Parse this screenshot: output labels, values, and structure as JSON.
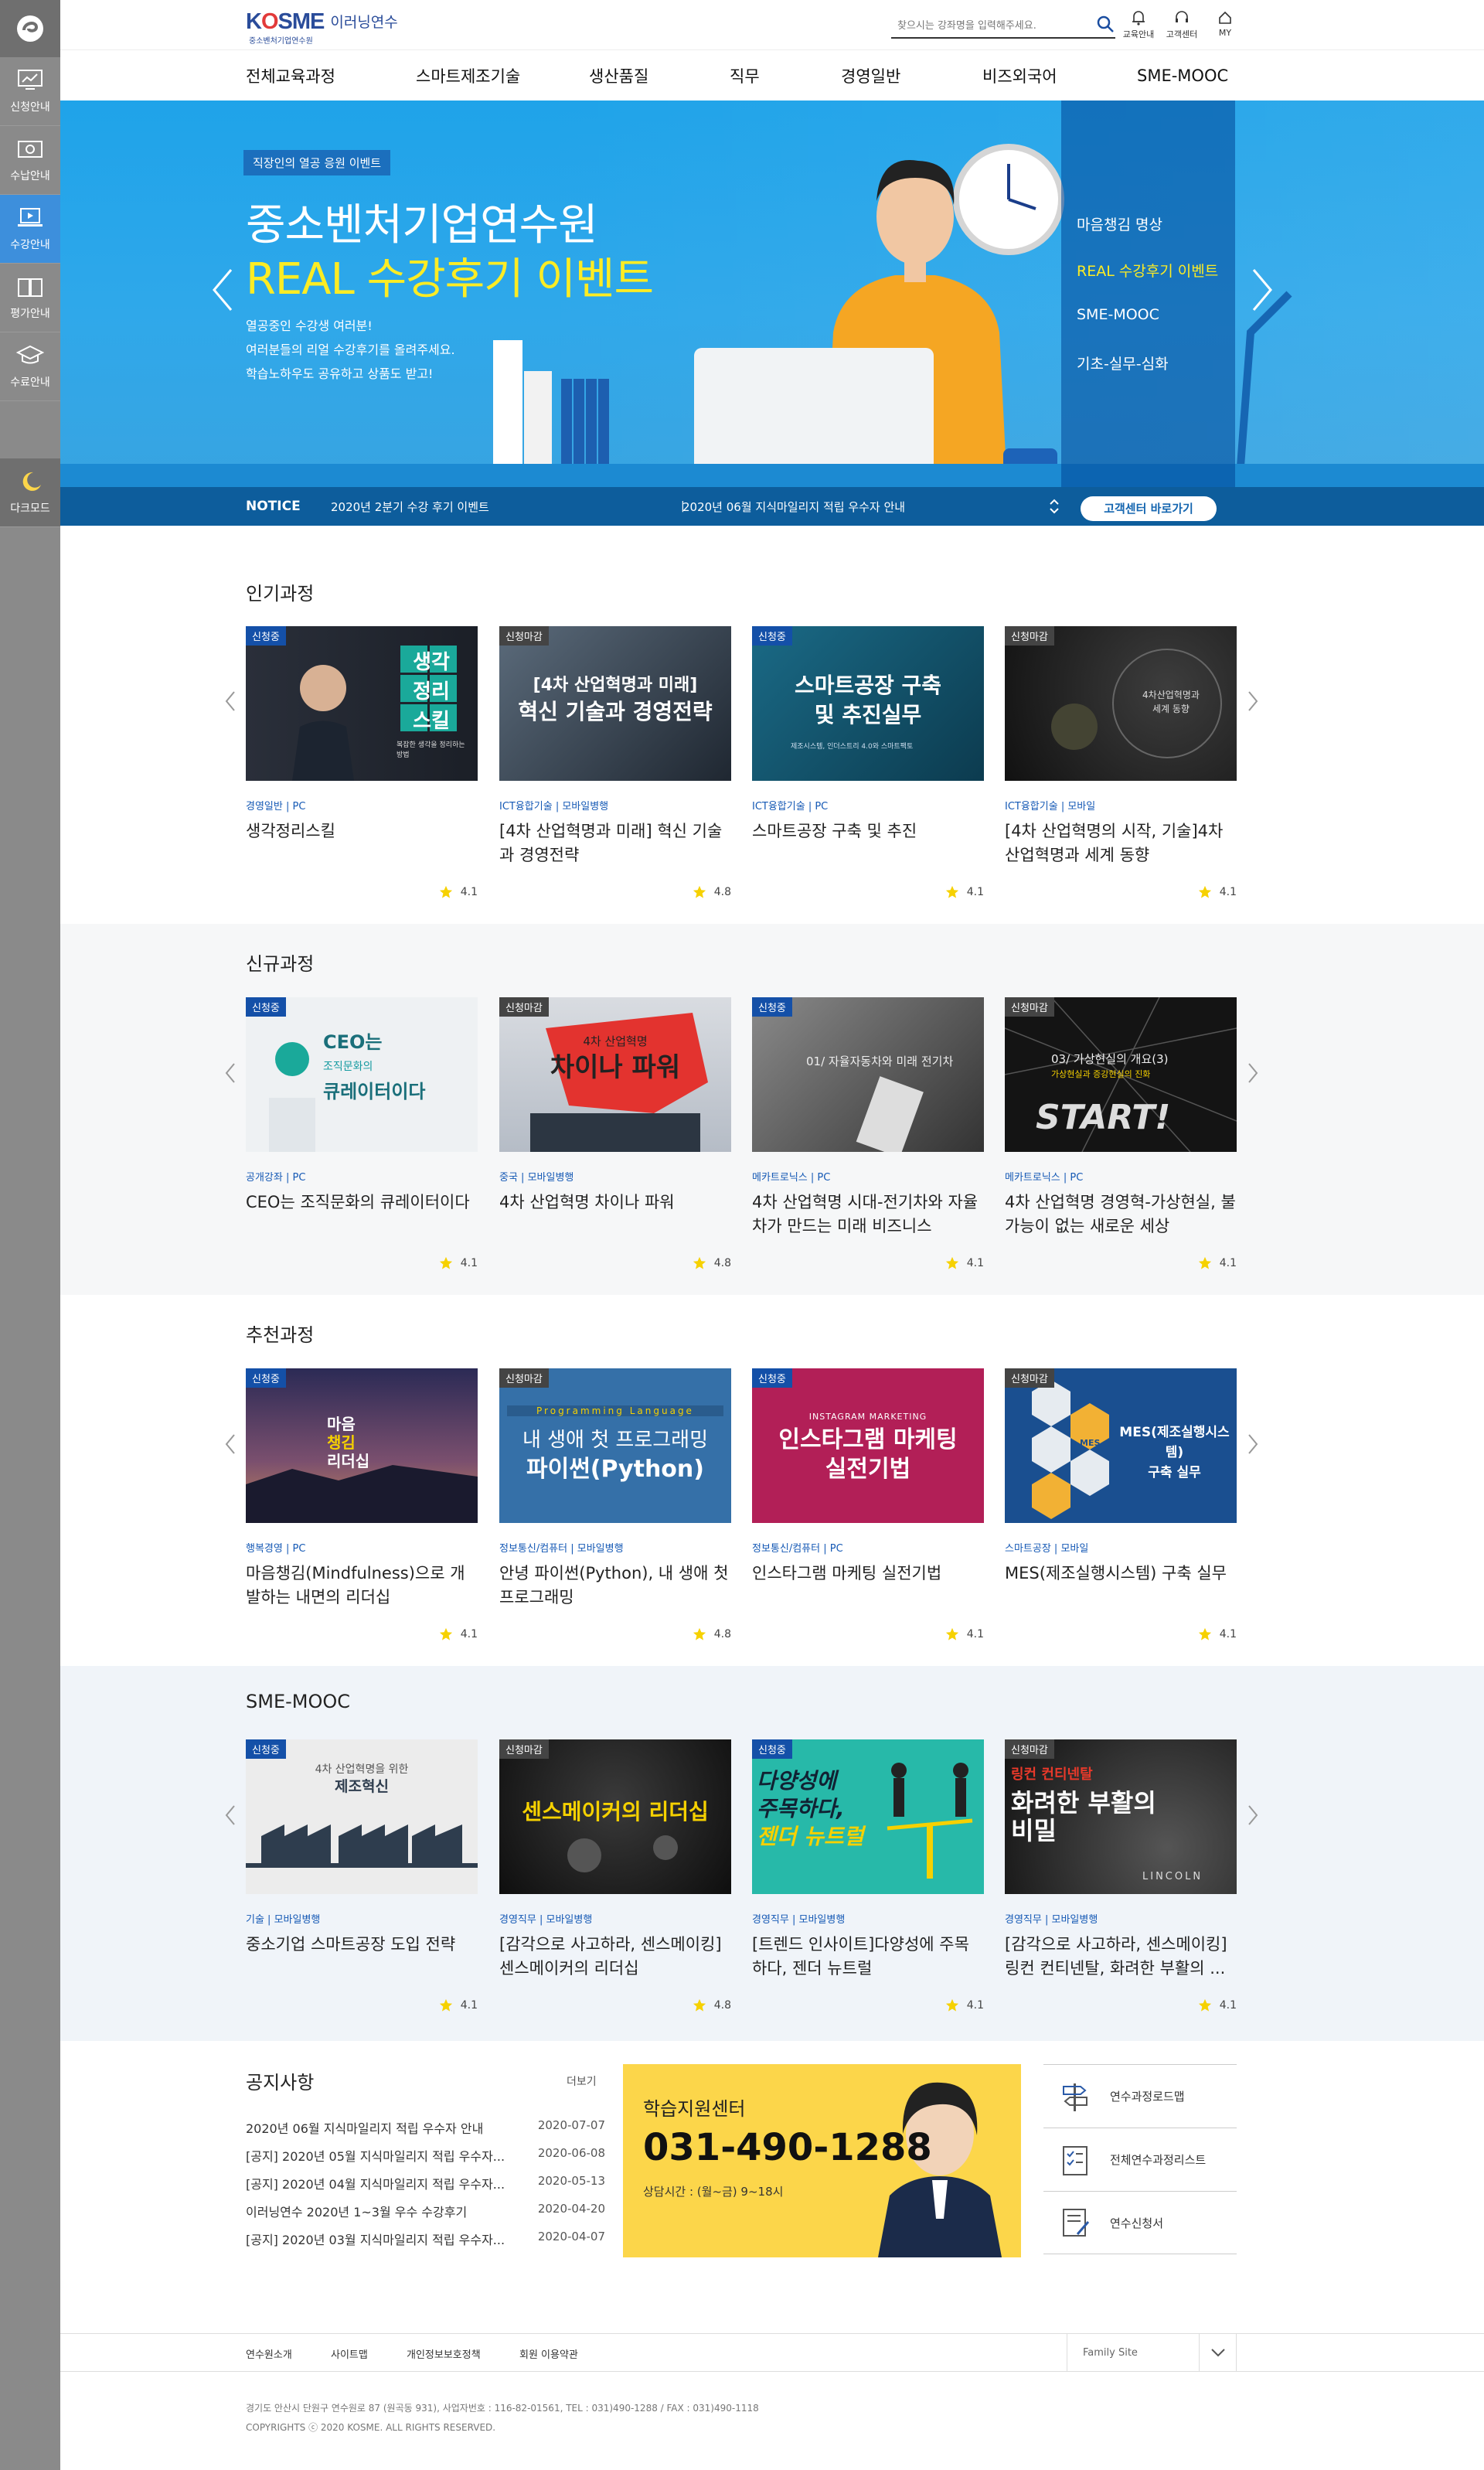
{
  "sidebar": {
    "items": [
      {
        "label": "신청안내",
        "icon": "monitor-icon"
      },
      {
        "label": "수납안내",
        "icon": "card-icon"
      },
      {
        "label": "수강안내",
        "icon": "laptop-icon"
      },
      {
        "label": "평가안내",
        "icon": "book-icon"
      },
      {
        "label": "수료안내",
        "icon": "grad-cap-icon"
      }
    ],
    "dark_mode": "다크모드"
  },
  "header": {
    "logo_text": "KOSME",
    "logo_sub": "중소벤처기업연수원",
    "logo_name": "이러닝연수",
    "search_placeholder": "찾으시는 강좌명을 입력해주세요.",
    "icons": [
      {
        "label": "교육안내",
        "icon": "bell-icon"
      },
      {
        "label": "고객센터",
        "icon": "headset-icon"
      },
      {
        "label": "MY",
        "icon": "home-icon"
      }
    ]
  },
  "gnb": [
    "전체교육과정",
    "스마트제조기술",
    "생산품질",
    "직무",
    "경영일반",
    "비즈외국어",
    "SME-MOOC"
  ],
  "hero": {
    "badge": "직장인의 열공 응원 이벤트",
    "title1": "중소벤처기업연수원",
    "title2": "REAL 수강후기 이벤트",
    "desc": [
      "열공중인 수강생 여러분!",
      "여러분들의 리얼 수강후기를 올려주세요.",
      "학습노하우도 공유하고 상품도 받고!"
    ],
    "menu": [
      "마음챙김 명상",
      "REAL 수강후기 이벤트",
      "SME-MOOC",
      "기초-실무-심화"
    ],
    "notice_label": "NOTICE",
    "notice_1": "2020년 2분기 수강 후기 이벤트",
    "notice_2": "2020년 06월 지식마일리지 적립 우수자 안내",
    "cs_button": "고객센터 바로가기"
  },
  "sections": [
    {
      "title": "인기과정",
      "cards": [
        {
          "tag": "신청중",
          "cat": "경영일반 | PC",
          "title": "생각정리스킬",
          "rating": "4.1"
        },
        {
          "tag": "신청마감",
          "cat": "ICT융합기술 | 모바일병행",
          "title": "[4차 산업혁명과 미래] 혁신 기술과 경영전략",
          "rating": "4.8"
        },
        {
          "tag": "신청중",
          "cat": "ICT융합기술 | PC",
          "title": "스마트공장 구축 및 추진",
          "rating": "4.1"
        },
        {
          "tag": "신청마감",
          "cat": "ICT융합기술 | 모바일",
          "title": "[4차 산업혁명의 시작, 기술]4차 산업혁명과 세계 동향",
          "rating": "4.1"
        }
      ]
    },
    {
      "title": "신규과정",
      "cards": [
        {
          "tag": "신청중",
          "cat": "공개강좌 | PC",
          "title": "CEO는 조직문화의 큐레이터이다",
          "rating": "4.1"
        },
        {
          "tag": "신청마감",
          "cat": "중국 | 모바일병행",
          "title": "4차 산업혁명 차이나 파워",
          "rating": "4.8"
        },
        {
          "tag": "신청중",
          "cat": "메카트로닉스 | PC",
          "title": "4차 산업혁명 시대-전기차와 자율차가 만드는 미래 비즈니스",
          "rating": "4.1"
        },
        {
          "tag": "신청마감",
          "cat": "메카트로닉스 | PC",
          "title": "4차 산업혁명 경영혁-가상현실, 불가능이 없는 새로운 세상",
          "rating": "4.1"
        }
      ]
    },
    {
      "title": "추천과정",
      "cards": [
        {
          "tag": "신청중",
          "cat": "행복경영 | PC",
          "title": "마음챙김(Mindfulness)으로 개발하는 내면의 리더십",
          "rating": "4.1"
        },
        {
          "tag": "신청마감",
          "cat": "정보통신/컴퓨터 | 모바일병행",
          "title": "안녕 파이썬(Python), 내 생애 첫 프로그래밍",
          "rating": "4.8"
        },
        {
          "tag": "신청중",
          "cat": "정보통신/컴퓨터 | PC",
          "title": "인스타그램 마케팅 실전기법",
          "rating": "4.1"
        },
        {
          "tag": "신청마감",
          "cat": "스마트공장 | 모바일",
          "title": "MES(제조실행시스템) 구축 실무",
          "rating": "4.1"
        }
      ]
    },
    {
      "title": "SME-MOOC",
      "cards": [
        {
          "tag": "신청중",
          "cat": "기술 | 모바일병행",
          "title": "중소기업 스마트공장 도입 전략",
          "rating": "4.1"
        },
        {
          "tag": "신청마감",
          "cat": "경영직무 | 모바일병행",
          "title": "[감각으로 사고하라, 센스메이킹] 센스메이커의 리더십",
          "rating": "4.8"
        },
        {
          "tag": "신청중",
          "cat": "경영직무 | 모바일병행",
          "title": "[트렌드 인사이트]다양성에 주목하다, 젠더 뉴트럴",
          "rating": "4.1"
        },
        {
          "tag": "신청마감",
          "cat": "경영직무 | 모바일병행",
          "title": "[감각으로 사고하라, 센스메이킹] 링컨 컨티넨탈, 화려한 부활의 ...",
          "rating": "4.1"
        }
      ]
    }
  ],
  "thumb_text": {
    "t1": [
      "생각",
      "정리",
      "스킬"
    ],
    "t1_sub": "복잡한 생각을 정리하는 방법",
    "t2": [
      "[4차 산업혁명과 미래]",
      "혁신 기술과 경영전략"
    ],
    "t3": [
      "스마트공장 구축",
      "및 추진실무"
    ],
    "t3_sub": "제조시스템, 인더스트리 4.0와 스마트팩토",
    "t4": [
      "4차산업혁명과",
      "세계 동향"
    ],
    "t5": [
      "CEO는",
      "조직문화의",
      "큐레이터이다"
    ],
    "t6": [
      "4차 산업혁명",
      "차이나 파워"
    ],
    "t7": "01/ 자율자동차와 미래 전기차",
    "t8": [
      "03/ 가상현실의 개요(3)",
      "가상현실과 증강현실의 진화",
      "START!"
    ],
    "t9": [
      "마음",
      "챙김",
      "리더십"
    ],
    "t10": [
      "Programming Language",
      "내 생애 첫 프로그래밍",
      "파이썬(Python)"
    ],
    "t11": [
      "INSTAGRAM MARKETING",
      "인스타그램 마케팅",
      "실전기법"
    ],
    "t12": [
      "MES(제조실행시스템)",
      "구축 실무",
      "MES"
    ],
    "t13": [
      "4차 산업혁명을 위한",
      "제조혁신"
    ],
    "t14": "센스메이커의 리더십",
    "t15": [
      "다양성에",
      "주목하다,",
      "젠더 뉴트럴"
    ],
    "t16": [
      "링컨 컨티넨탈",
      "화려한 부활의",
      "비밀",
      "LINCOLN"
    ]
  },
  "notices": {
    "title": "공지사항",
    "more": "더보기",
    "items": [
      {
        "text": "2020년 06월 지식마일리지 적립 우수자 안내",
        "date": "2020-07-07"
      },
      {
        "text": "[공지] 2020년 05월 지식마일리지 적립 우수자...",
        "date": "2020-06-08"
      },
      {
        "text": "[공지] 2020년 04월 지식마일리지 적립 우수자...",
        "date": "2020-05-13"
      },
      {
        "text": "이러닝연수 2020년 1~3월 우수 수강후기",
        "date": "2020-04-20"
      },
      {
        "text": "[공지] 2020년 03월 지식마일리지 적립 우수자...",
        "date": "2020-04-07"
      }
    ]
  },
  "callcenter": {
    "title": "학습지원센터",
    "number": "031-490-1288",
    "hours": "상담시간 : (월~금) 9~18시"
  },
  "quicklinks": [
    {
      "label": "연수과정로드맵",
      "icon": "signpost-icon"
    },
    {
      "label": "전체연수과정리스트",
      "icon": "checklist-icon"
    },
    {
      "label": "연수신청서",
      "icon": "form-icon"
    }
  ],
  "footer": {
    "links": [
      "연수원소개",
      "사이트맵",
      "개인정보보호정책",
      "회원 이용약관"
    ],
    "family_site": "Family Site",
    "address": "경기도 안산시 단원구 연수원로 87 (원곡동 931), 사업자번호 : 116-82-01561, TEL : 031)490-1288 / FAX : 031)490-1118",
    "copyright": "COPYRIGHTS ⓒ 2020 KOSME. ALL RIGHTS RESERVED."
  }
}
